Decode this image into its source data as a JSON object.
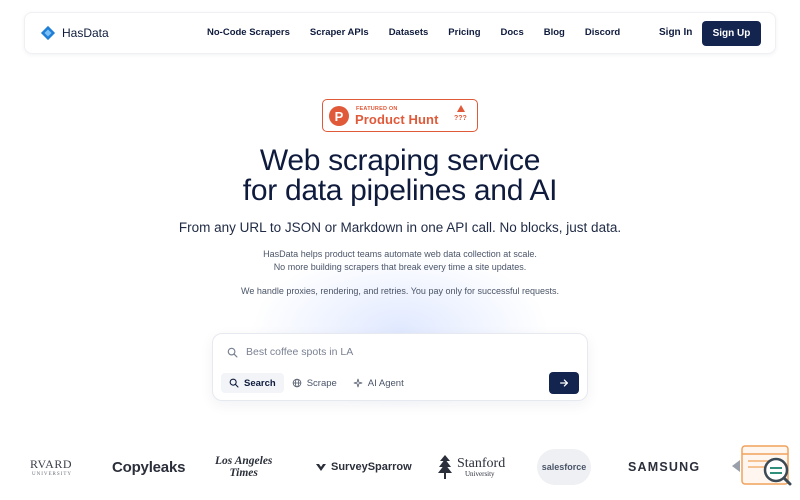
{
  "brand": {
    "name": "HasData"
  },
  "nav": {
    "links": [
      "No-Code Scrapers",
      "Scraper APIs",
      "Datasets",
      "Pricing",
      "Docs",
      "Blog",
      "Discord"
    ],
    "sign_in": "Sign In",
    "sign_up": "Sign Up"
  },
  "badge": {
    "featured_on": "FEATURED ON",
    "name": "Product Hunt",
    "count": "???"
  },
  "hero": {
    "title_line1": "Web scraping service",
    "title_line2": "for data pipelines and AI",
    "subtitle": "From any URL to JSON or Markdown in one API call. No blocks, just data.",
    "desc_line1": "HasData helps product teams automate web data collection at scale.",
    "desc_line2": "No more building scrapers that break every time a site updates.",
    "desc_line3": "We handle proxies, rendering, and retries. You pay only for successful requests."
  },
  "search": {
    "placeholder": "Best coffee spots in LA",
    "tabs": [
      "Search",
      "Scrape",
      "AI Agent"
    ],
    "active_tab": "Search"
  },
  "logos": {
    "harvard": "RVARD",
    "harvard_sub": "UNIVERSITY",
    "copyleaks": "Copyleaks",
    "lat_line1": "Los Angeles",
    "lat_line2": "Times",
    "surveysparrow": "SurveySparrow",
    "stanford": "Stanford",
    "stanford_sub": "University",
    "salesforce": "salesforce",
    "samsung": "SAMSUNG"
  },
  "colors": {
    "navy": "#13244f",
    "producthunt": "#e05a3a",
    "brand_blue": "#1f7fd6"
  }
}
